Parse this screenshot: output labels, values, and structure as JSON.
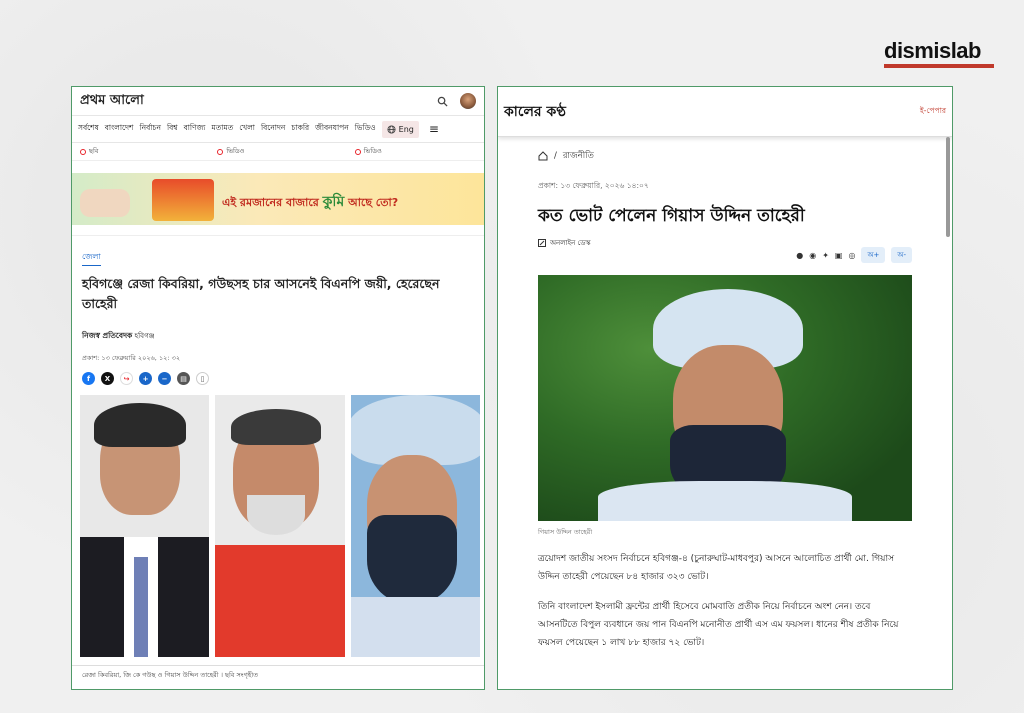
{
  "brand": {
    "name": "dismislab"
  },
  "left": {
    "logo": "প্রথম আলো",
    "nav": [
      "সর্বশেষ",
      "বাংলাদেশ",
      "নির্বাচন",
      "বিশ্ব",
      "বাণিজ্য",
      "মতামত",
      "খেলা",
      "বিনোদন",
      "চাকরি",
      "জীবনযাপন",
      "ভিডিও"
    ],
    "lang_button": "Eng",
    "tabs": [
      "ছবি",
      "ভিডিও",
      "ভিডিও"
    ],
    "banner_text": "এই রমজানের বাজারে",
    "banner_brand": "কুমি",
    "banner_tail": "আছে তো?",
    "category": "জেলা",
    "headline": "হবিগঞ্জে রেজা কিবরিয়া, গউছসহ চার আসনেই বিএনপি জয়ী, হেরেছেন তাহেরী",
    "author": "নিজস্ব প্রতিবেদক",
    "author_place": "হবিগঞ্জ",
    "date": "প্রকাশ: ১৩ ফেব্রুয়ারি ২০২৬, ১২: ৩২",
    "share_icons": [
      "facebook-icon",
      "x-icon",
      "share-icon",
      "font-plus-icon",
      "font-minus-icon",
      "print-icon",
      "bookmark-icon"
    ],
    "caption": "রেজা কিবরিয়া, জি কে গউছ ও গিয়াস উদ্দিন তাহেরী । ছবি সংগৃহীত"
  },
  "right": {
    "logo": "কালের কণ্ঠ",
    "epaper": "ই-পেপার",
    "breadcrumb": "রাজনীতি",
    "date": "প্রকাশ: ১৩ ফেব্রুয়ারি, ২০২৬ ১৪:০৭",
    "headline": "কত ভোট পেলেন গিয়াস উদ্দিন তাহেরী",
    "byline": "অনলাইন ডেস্ক",
    "font_minus": "অ-",
    "font_plus": "অ+",
    "caption": "গিয়াস উদ্দিন তাহেরী",
    "para1": "ত্রয়োদশ জাতীয় সংসদ নির্বাচনে হবিগঞ্জ-৪ (চুনারুঘাট-মাধবপুর) আসনে আলোচিত প্রার্থী মো. গিয়াস উদ্দিন তাহেরী পেয়েছেন ৮৪ হাজার ৩২৩ ভোট।",
    "para2": "তিনি বাংলাদেশ ইসলামী ফ্রন্টের প্রার্থী হিসেবে মোমবাতি প্রতীক নিয়ে নির্বাচনে অংশ নেন। তবে আসনটিতে বিপুল ব্যবধানে জয় পান বিএনপি মনোনীত প্রার্থী এস এম ফয়সল। ধানের শীষ প্রতীক নিয়ে ফয়সল পেয়েছেন ১ লাখ ৮৮ হাজার ৭২ ভোট।"
  },
  "colors": {
    "frame": "#4f9a68",
    "accent": "#c0392b",
    "link": "#1a67c9"
  }
}
